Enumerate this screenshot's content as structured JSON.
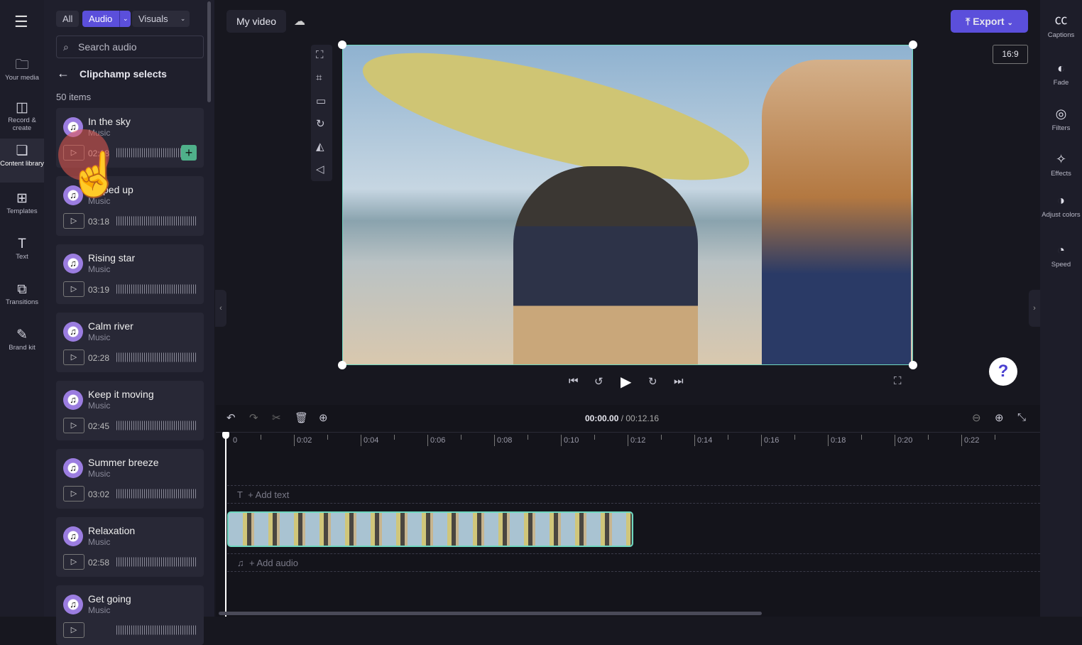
{
  "nav": [
    {
      "label": "Your media",
      "icon": "folder-icon"
    },
    {
      "label": "Record & create",
      "icon": "camera-icon"
    },
    {
      "label": "Content library",
      "icon": "content-library-icon"
    },
    {
      "label": "Templates",
      "icon": "templates-icon"
    },
    {
      "label": "Text",
      "icon": "text-icon"
    },
    {
      "label": "Transitions",
      "icon": "transitions-icon"
    },
    {
      "label": "Brand kit",
      "icon": "brand-kit-icon"
    }
  ],
  "panel": {
    "filters": [
      "All",
      "Audio",
      "Visuals"
    ],
    "search_placeholder": "Search audio",
    "back_title": "Clipchamp selects",
    "count": "50 items",
    "items": [
      {
        "title": "In the sky",
        "type": "Music",
        "duration": "02:18"
      },
      {
        "title": "Amped up",
        "type": "Music",
        "duration": "03:18"
      },
      {
        "title": "Rising star",
        "type": "Music",
        "duration": "03:19"
      },
      {
        "title": "Calm river",
        "type": "Music",
        "duration": "02:28"
      },
      {
        "title": "Keep it moving",
        "type": "Music",
        "duration": "02:45"
      },
      {
        "title": "Summer breeze",
        "type": "Music",
        "duration": "03:02"
      },
      {
        "title": "Relaxation",
        "type": "Music",
        "duration": "02:58"
      },
      {
        "title": "Get going",
        "type": "Music",
        "duration": ""
      }
    ]
  },
  "header": {
    "title": "My video",
    "export": "Export",
    "aspect": "16:9"
  },
  "right": [
    {
      "label": "Captions",
      "icon": "captions-icon"
    },
    {
      "label": "Fade",
      "icon": "fade-icon"
    },
    {
      "label": "Filters",
      "icon": "filters-icon"
    },
    {
      "label": "Effects",
      "icon": "effects-icon"
    },
    {
      "label": "Adjust colors",
      "icon": "adjust-colors-icon"
    },
    {
      "label": "Speed",
      "icon": "speed-icon"
    }
  ],
  "timeline": {
    "current": "00:00.00",
    "total": "/ 00:12.16",
    "ticks": [
      "0",
      "0:02",
      "0:04",
      "0:06",
      "0:08",
      "0:10",
      "0:12",
      "0:14",
      "0:16",
      "0:18",
      "0:20",
      "0:22"
    ],
    "add_text": "+ Add text",
    "add_audio": "+ Add audio",
    "clip_duration_s": 12.16
  },
  "colors": {
    "accent": "#5b4fdb",
    "selection": "#6fd8c0",
    "add": "#4fb08a"
  }
}
